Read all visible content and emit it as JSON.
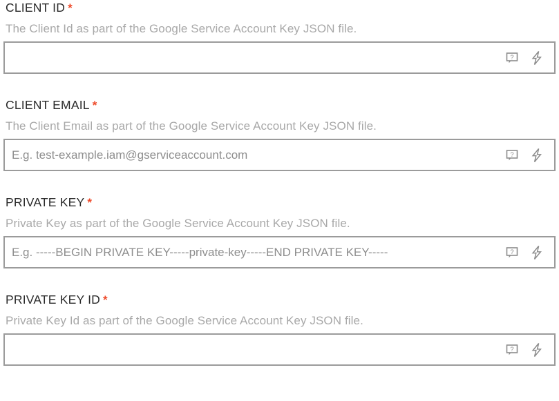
{
  "form": {
    "required_marker": "*",
    "colors": {
      "label": "#2b2b2b",
      "required": "#ee4b2b",
      "description": "#a8a8a8",
      "placeholder": "#8e8e8e",
      "input_border": "#9b9b9b",
      "icon": "#8c8c8c",
      "background": "#ffffff"
    },
    "icons": {
      "help": "help-comment-icon",
      "lightning": "lightning-bolt-icon",
      "help_glyph": "?"
    },
    "fields": [
      {
        "label": "CLIENT ID",
        "required": true,
        "description": "The Client Id as part of the Google Service Account Key JSON file.",
        "value": "",
        "placeholder": ""
      },
      {
        "label": "CLIENT EMAIL",
        "required": true,
        "description": "The Client Email as part of the Google Service Account Key JSON file.",
        "value": "",
        "placeholder": "E.g. test-example.iam@gserviceaccount.com"
      },
      {
        "label": "PRIVATE KEY",
        "required": true,
        "description": "Private Key as part of the Google Service Account Key JSON file.",
        "value": "",
        "placeholder": "E.g. -----BEGIN PRIVATE KEY-----private-key-----END PRIVATE KEY-----"
      },
      {
        "label": "PRIVATE KEY ID",
        "required": true,
        "description": "Private Key Id as part of the Google Service Account Key JSON file.",
        "value": "",
        "placeholder": ""
      }
    ]
  }
}
